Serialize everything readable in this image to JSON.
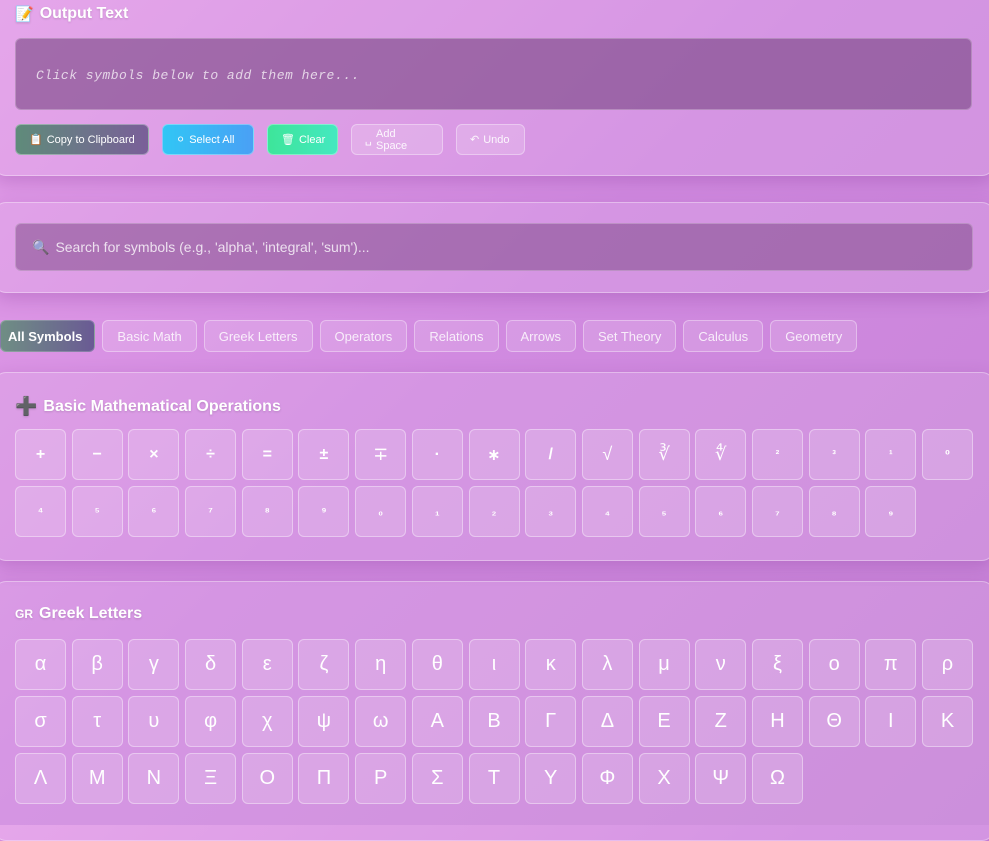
{
  "output": {
    "title": "Output Text",
    "title_icon": "📝",
    "placeholder": "Click symbols below to add them here...",
    "buttons": [
      {
        "icon": "📋",
        "label": "Copy to Clipboard"
      },
      {
        "icon": "⚪",
        "label": "Select All"
      },
      {
        "icon": "🗑",
        "label": "Clear"
      },
      {
        "icon": "␣",
        "label": "Add Space"
      },
      {
        "icon": "↶",
        "label": "Undo"
      }
    ]
  },
  "search": {
    "icon": "🔍",
    "placeholder": "Search for symbols (e.g., 'alpha', 'integral', 'sum')..."
  },
  "tabs": [
    "All Symbols",
    "Basic Math",
    "Greek Letters",
    "Operators",
    "Relations",
    "Arrows",
    "Set Theory",
    "Calculus",
    "Geometry"
  ],
  "basic": {
    "title": "Basic Mathematical Operations",
    "title_icon": "➕",
    "symbols": [
      "+",
      "−",
      "×",
      "÷",
      "=",
      "±",
      "∓",
      "·",
      "∗",
      "/",
      "√",
      "∛",
      "∜",
      "²",
      "³",
      "¹",
      "⁰",
      "⁴",
      "⁵",
      "⁶",
      "⁷",
      "⁸",
      "⁹",
      "₀",
      "₁",
      "₂",
      "₃",
      "₄",
      "₅",
      "₆",
      "₇",
      "₈",
      "₉"
    ]
  },
  "greek": {
    "title": "Greek Letters",
    "title_icon": "GR",
    "symbols": [
      "α",
      "β",
      "γ",
      "δ",
      "ε",
      "ζ",
      "η",
      "θ",
      "ι",
      "κ",
      "λ",
      "μ",
      "ν",
      "ξ",
      "ο",
      "π",
      "ρ",
      "σ",
      "τ",
      "υ",
      "φ",
      "χ",
      "ψ",
      "ω",
      "Α",
      "Β",
      "Γ",
      "Δ",
      "Ε",
      "Ζ",
      "Η",
      "Θ",
      "Ι",
      "Κ",
      "Λ",
      "Μ",
      "Ν",
      "Ξ",
      "Ο",
      "Π",
      "Ρ",
      "Σ",
      "Τ",
      "Υ",
      "Φ",
      "Χ",
      "Ψ",
      "Ω"
    ]
  }
}
